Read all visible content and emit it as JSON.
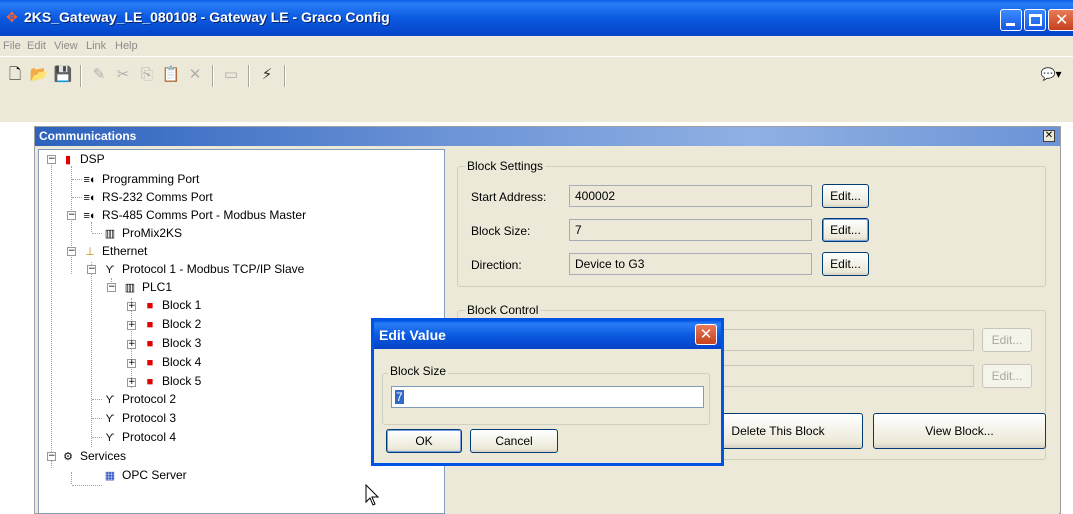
{
  "window": {
    "title": "2KS_Gateway_LE_080108 - Gateway LE - Graco Config",
    "app_icon": "graco-app-icon"
  },
  "menu": {
    "items": [
      "File",
      "Edit",
      "View",
      "Link",
      "Help"
    ]
  },
  "toolbar": {
    "buttons": [
      {
        "name": "new-icon",
        "glyph": "🗋",
        "enabled": true
      },
      {
        "name": "open-icon",
        "glyph": "📂",
        "enabled": true
      },
      {
        "name": "save-icon",
        "glyph": "💾",
        "enabled": true
      },
      {
        "name": "edit-icon",
        "glyph": "✎",
        "enabled": false
      },
      {
        "name": "cut-icon",
        "glyph": "✂",
        "enabled": false
      },
      {
        "name": "copy-icon",
        "glyph": "⎘",
        "enabled": false
      },
      {
        "name": "paste-icon",
        "glyph": "📋",
        "enabled": false
      },
      {
        "name": "delete-icon",
        "glyph": "✕",
        "enabled": false
      },
      {
        "name": "window-icon",
        "glyph": "▭",
        "enabled": false
      },
      {
        "name": "lightning-icon",
        "glyph": "⚡",
        "enabled": true
      }
    ],
    "right_icon": "comment-icon"
  },
  "panel": {
    "title": "Communications"
  },
  "tree": {
    "nodes": [
      {
        "label": "DSP",
        "icon": "dsp-icon"
      },
      {
        "label": "Programming Port",
        "icon": "port-icon"
      },
      {
        "label": "RS-232 Comms Port",
        "icon": "port-icon"
      },
      {
        "label": "RS-485 Comms Port - Modbus Master",
        "icon": "port-icon"
      },
      {
        "label": "ProMix2KS",
        "icon": "device-icon"
      },
      {
        "label": "Ethernet",
        "icon": "ethernet-icon"
      },
      {
        "label": "Protocol 1 - Modbus TCP/IP Slave",
        "icon": "protocol-icon"
      },
      {
        "label": "PLC1",
        "icon": "device-icon"
      },
      {
        "label": "Block 1",
        "icon": "block-icon"
      },
      {
        "label": "Block 2",
        "icon": "block-icon"
      },
      {
        "label": "Block 3",
        "icon": "block-icon"
      },
      {
        "label": "Block 4",
        "icon": "block-icon"
      },
      {
        "label": "Block 5",
        "icon": "block-icon"
      },
      {
        "label": "Protocol 2",
        "icon": "protocol-icon"
      },
      {
        "label": "Protocol 3",
        "icon": "protocol-icon"
      },
      {
        "label": "Protocol 4",
        "icon": "protocol-icon"
      },
      {
        "label": "Services",
        "icon": "services-icon"
      },
      {
        "label": "OPC Server",
        "icon": "opc-server-icon"
      }
    ]
  },
  "block_settings": {
    "group_label": "Block Settings",
    "start_address_label": "Start Address:",
    "start_address_value": "400002",
    "block_size_label": "Block Size:",
    "block_size_value": "7",
    "direction_label": "Direction:",
    "direction_value": "Device to G3",
    "edit_label": "Edit..."
  },
  "block_control": {
    "group_label": "Block Control",
    "edit_label": "Edit...",
    "delete_label": "Delete This Block",
    "view_label": "View Block..."
  },
  "dialog": {
    "title": "Edit Value",
    "group_label": "Block Size",
    "value": "7",
    "ok_label": "OK",
    "cancel_label": "Cancel"
  }
}
